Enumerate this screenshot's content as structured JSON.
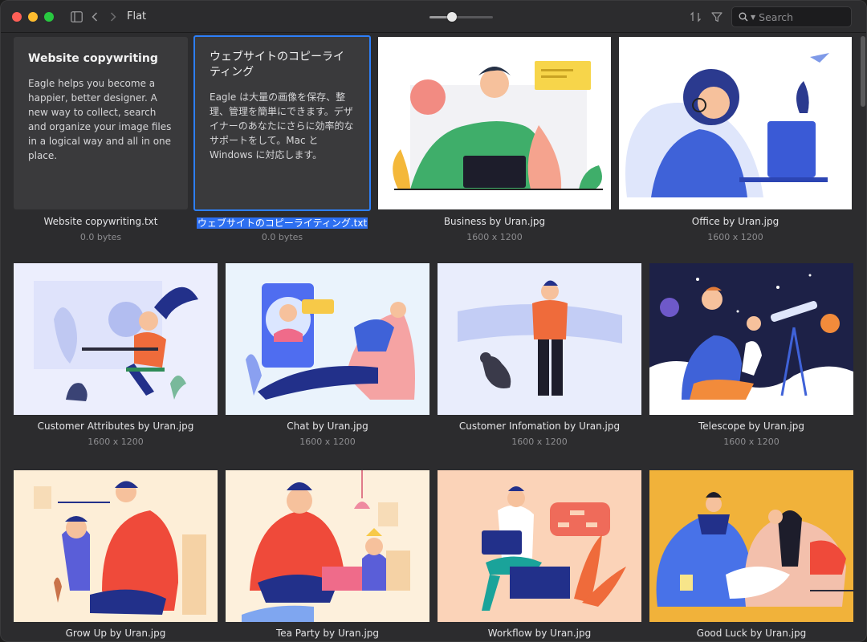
{
  "window": {
    "folder_title": "Flat",
    "zoom": 0.35,
    "search_placeholder": "Search"
  },
  "icons": {
    "close": "close-dot",
    "minimize": "minimize-dot",
    "maximize": "maximize-dot",
    "sidebar": "sidebar-icon",
    "back": "chevron-left-icon",
    "forward": "chevron-right-icon",
    "sort": "sort-icon",
    "filter": "filter-icon",
    "search": "search-icon"
  },
  "colors": {
    "accent": "#2d7ff9",
    "selection": "#2d6ff0"
  },
  "items": [
    {
      "kind": "text",
      "title": "Website copywriting",
      "body": "Eagle helps you become a happier, better designer. A new way to collect, search and organize your image files in a logical way and all in one place.",
      "name": "Website copywriting.txt",
      "meta": "0.0 bytes"
    },
    {
      "kind": "text",
      "title": "ウェブサイトのコピーライティング",
      "body": "Eagle は大量の画像を保存、整理、管理を簡単にできます。デザイナーのあなたにさらに効率的なサポートをして。Mac と Windows に対応します。",
      "name": "ウェブサイトのコピーライティング.txt",
      "meta": "0.0 bytes"
    },
    {
      "kind": "image",
      "name": "Business by Uran.jpg",
      "meta": "1600 x 1200"
    },
    {
      "kind": "image",
      "name": "Office by Uran.jpg",
      "meta": "1600 x 1200"
    },
    {
      "kind": "image",
      "name": "Customer Attributes by Uran.jpg",
      "meta": "1600 x 1200"
    },
    {
      "kind": "image",
      "name": "Chat by Uran.jpg",
      "meta": "1600 x 1200"
    },
    {
      "kind": "image",
      "name": "Customer Infomation by Uran.jpg",
      "meta": "1600 x 1200"
    },
    {
      "kind": "image",
      "name": "Telescope by Uran.jpg",
      "meta": "1600 x 1200"
    },
    {
      "kind": "image",
      "name": "Grow Up by Uran.jpg",
      "meta": ""
    },
    {
      "kind": "image",
      "name": "Tea Party by Uran.jpg",
      "meta": ""
    },
    {
      "kind": "image",
      "name": "Workflow by Uran.jpg",
      "meta": ""
    },
    {
      "kind": "image",
      "name": "Good Luck by Uran.jpg",
      "meta": ""
    }
  ]
}
